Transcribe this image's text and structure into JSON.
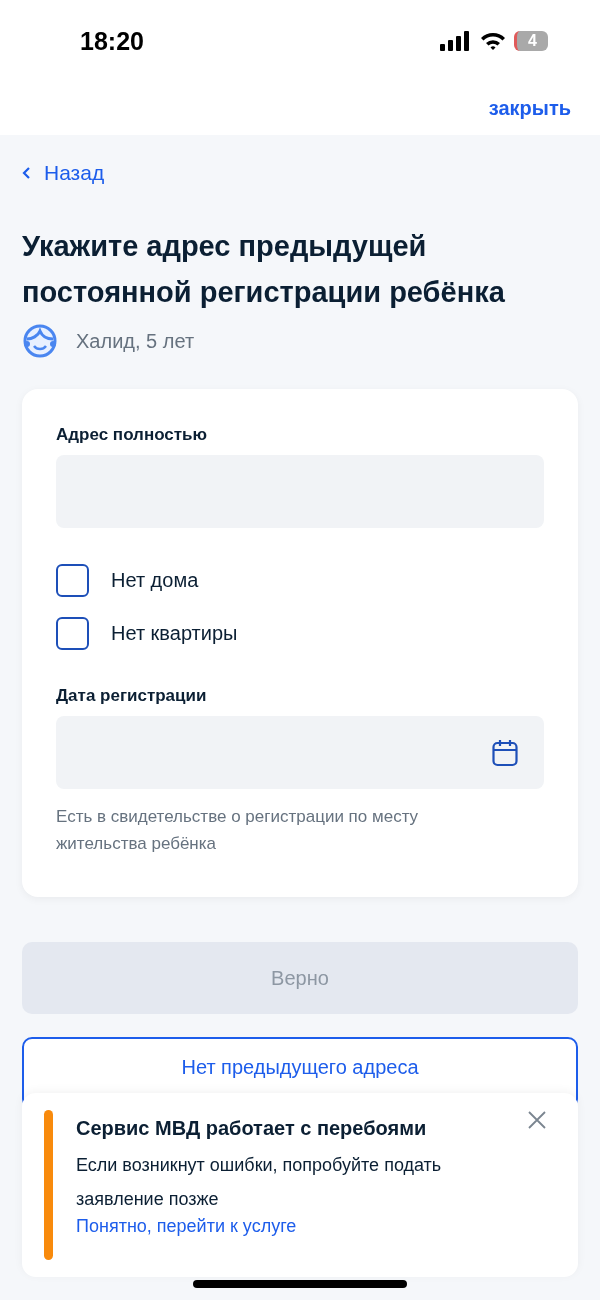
{
  "status_bar": {
    "time": "18:20",
    "battery": "4"
  },
  "header": {
    "close": "закрыть"
  },
  "back": "Назад",
  "title": "Укажите адрес предыдущей постоянной регистрации ребёнка",
  "child": "Халид, 5 лет",
  "form": [
    {
      "kind": "text",
      "label": "Адрес полностью"
    },
    {
      "kind": "checkbox",
      "label": "Нет дома",
      "checked": false
    },
    {
      "kind": "checkbox",
      "label": "Нет квартиры",
      "checked": false
    },
    {
      "kind": "date",
      "label": "Дата регистрации",
      "hint": "Есть в свидетельстве о регистрации по месту жительства ребёнка"
    }
  ],
  "buttons": [
    {
      "kind": "primary",
      "label": "Верно",
      "disabled": true
    },
    {
      "kind": "outline",
      "label": "Нет предыдущего адреса",
      "disabled": false
    }
  ],
  "toast": {
    "title": "Сервис МВД работает с перебоями",
    "text": "Если возникнут ошибки, попробуйте подать заявление позже",
    "link": "Понятно, перейти к услуге"
  }
}
